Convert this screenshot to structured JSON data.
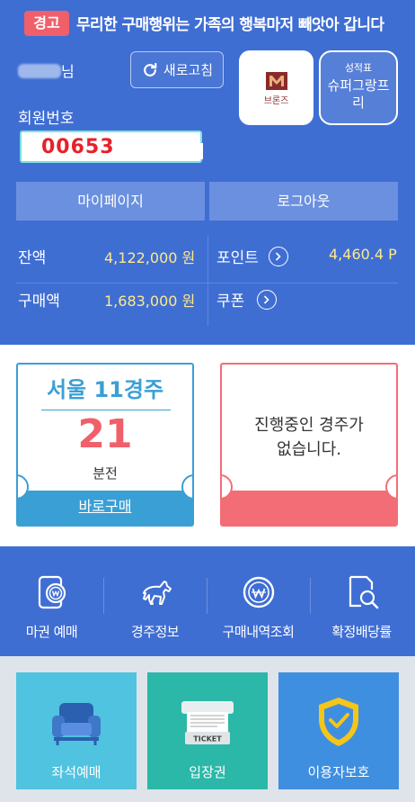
{
  "warning": {
    "tag": "경고",
    "message": "무리한 구매행위는 가족의 행복마저 빼앗아 갑니다"
  },
  "user": {
    "name_suffix": "님",
    "member_label": "회원번호",
    "member_number": "00653"
  },
  "refresh_label": "새로고침",
  "grade": {
    "label": "브론즈",
    "table_title": "성적표",
    "table_subtitle": "슈퍼그랑프리"
  },
  "actions": {
    "mypage": "마이페이지",
    "logout": "로그아웃"
  },
  "stats": {
    "balance_label": "잔액",
    "balance_value": "4,122,000 원",
    "point_label": "포인트",
    "point_value": "4,460.4 P",
    "purchase_label": "구매액",
    "purchase_value": "1,683,000 원",
    "coupon_label": "쿠폰"
  },
  "race": {
    "title": "서울 11경주",
    "count": "21",
    "unit": "분전",
    "buy_label": "바로구매"
  },
  "no_race": {
    "line1": "진행중인 경주가",
    "line2": "없습니다."
  },
  "menu": [
    {
      "label": "마권 예매",
      "icon": "phone-w-icon"
    },
    {
      "label": "경주정보",
      "icon": "horse-icon"
    },
    {
      "label": "구매내역조회",
      "icon": "w-coin-icon"
    },
    {
      "label": "확정배당률",
      "icon": "document-search-icon"
    }
  ],
  "tiles": [
    {
      "label": "좌석예매",
      "icon": "armchair-icon",
      "color": "#4fc3e0"
    },
    {
      "label": "입장권",
      "icon": "ticket-icon",
      "color": "#2bb8a8"
    },
    {
      "label": "이용자보호",
      "icon": "shield-check-icon",
      "color": "#3f8fe0"
    }
  ],
  "colors": {
    "primary": "#3f6ed3",
    "warning": "#f0606a",
    "race_blue": "#3a9fd5",
    "race_red": "#f36d76",
    "value_yellow": "#ffe98a"
  }
}
